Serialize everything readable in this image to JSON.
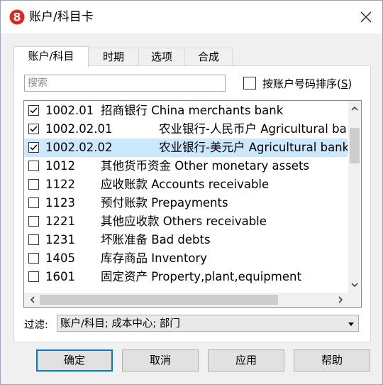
{
  "window": {
    "title": "账户/科目卡"
  },
  "tabs": [
    {
      "label": "账户/科目",
      "active": true
    },
    {
      "label": "时期",
      "active": false
    },
    {
      "label": "选项",
      "active": false
    },
    {
      "label": "合成",
      "active": false
    }
  ],
  "search": {
    "placeholder": "搜索",
    "value": ""
  },
  "sort": {
    "label_prefix": "按账户号码排序(",
    "hotkey": "S",
    "label_suffix": ")",
    "checked": false
  },
  "accounts": [
    {
      "code": "1002.01",
      "name": "招商银行 China merchants bank",
      "checked": true,
      "selected": false
    },
    {
      "code": "1002.02.01",
      "name": "农业银行-人民币户 Agricultural bank",
      "checked": true,
      "selected": false
    },
    {
      "code": "1002.02.02",
      "name": "农业银行-美元户 Agricultural bank",
      "checked": true,
      "selected": true
    },
    {
      "code": "1012",
      "name": "其他货币资金 Other monetary assets",
      "checked": false,
      "selected": false
    },
    {
      "code": "1122",
      "name": "应收账款 Accounts receivable",
      "checked": false,
      "selected": false
    },
    {
      "code": "1123",
      "name": "预付账款 Prepayments",
      "checked": false,
      "selected": false
    },
    {
      "code": "1221",
      "name": "其他应收款 Others receivable",
      "checked": false,
      "selected": false
    },
    {
      "code": "1231",
      "name": "坏账准备 Bad debts",
      "checked": false,
      "selected": false
    },
    {
      "code": "1405",
      "name": "库存商品 Inventory",
      "checked": false,
      "selected": false
    },
    {
      "code": "1601",
      "name": "固定资产 Property,plant,equipment",
      "checked": false,
      "selected": false
    }
  ],
  "filter": {
    "label": "过滤:",
    "value": "账户/科目; 成本中心; 部门"
  },
  "buttons": {
    "ok": "确定",
    "cancel": "取消",
    "apply": "应用",
    "help": "帮助"
  },
  "colors": {
    "accent": "#0078d7",
    "selection": "#cce8ff",
    "logo_red": "#e1251b"
  }
}
